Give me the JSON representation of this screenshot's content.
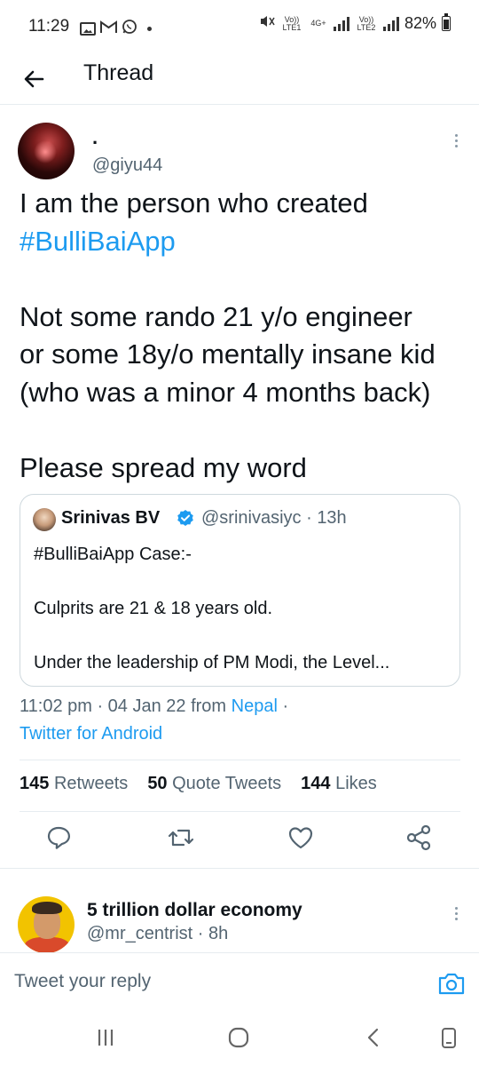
{
  "status_bar": {
    "time": "11:29",
    "battery": "82%",
    "network_1": "Vo)) LTE1",
    "network_type": "4G+",
    "network_2": "Vo)) LTE2"
  },
  "header": {
    "title": "Thread"
  },
  "tweet": {
    "display_name": ".",
    "handle": "@giyu44",
    "text_lines": [
      "I am the person who created",
      "#BulliBaiApp",
      "",
      "Not some rando 21 y/o engineer",
      "or some 18y/o mentally insane kid",
      "(who was a minor 4 months back)",
      "",
      "Please spread my word"
    ],
    "quote": {
      "name": "Srinivas BV",
      "handle_time": "@srinivasiyc · 13h",
      "text_lines": [
        "#BulliBaiApp Case:-",
        "",
        "Culprits are 21 & 18 years old.",
        "",
        "Under the leadership of PM Modi, the Level..."
      ]
    },
    "time": "11:02 pm · 04 Jan 22 from",
    "location": "Nepal",
    "separator": " ·",
    "source": "Twitter for Android",
    "stats": [
      {
        "count": "145",
        "label": "Retweets"
      },
      {
        "count": "50",
        "label": "Quote Tweets"
      },
      {
        "count": "144",
        "label": "Likes"
      }
    ],
    "accent_color": "#1d9bf0"
  },
  "reply_preview": {
    "display_name": "5 trillion dollar economy",
    "handle_time": "@mr_centrist · 8h"
  },
  "reply_bar": {
    "placeholder": "Tweet your reply"
  },
  "icons": {
    "back": "arrow-left-icon",
    "more": "more-vertical-icon",
    "verified": "verified-badge-icon",
    "reply": "reply-icon",
    "retweet": "retweet-icon",
    "like": "heart-icon",
    "share": "share-icon",
    "camera": "camera-icon",
    "nav_recents": "recents-icon",
    "nav_home": "home-icon",
    "nav_back": "nav-back-icon",
    "nav_screen": "screen-icon"
  }
}
